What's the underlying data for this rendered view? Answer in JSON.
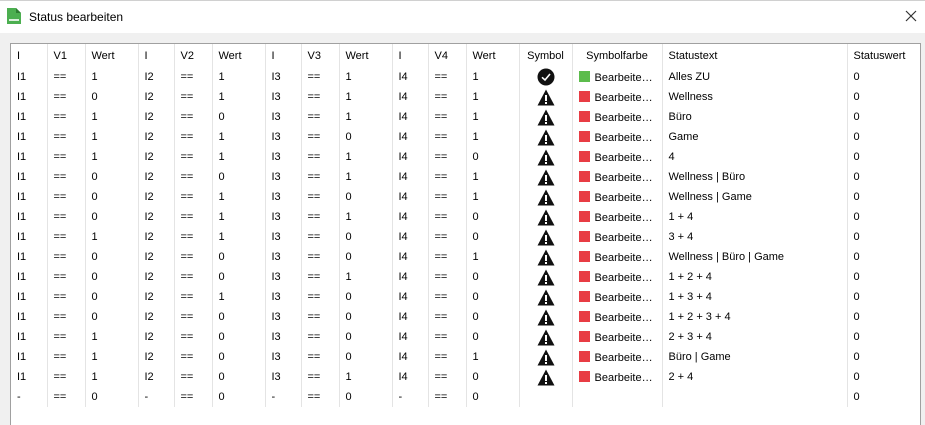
{
  "window": {
    "title": "Status bearbeiten"
  },
  "colors": {
    "green": "#5cbc4c",
    "red": "#e83c44"
  },
  "columns": [
    "I",
    "V1",
    "Wert",
    "I",
    "V2",
    "Wert",
    "I",
    "V3",
    "Wert",
    "I",
    "V4",
    "Wert",
    "Symbol",
    "Symbolfarbe",
    "Statustext",
    "Statuswert"
  ],
  "rows": [
    {
      "i1": "I1",
      "v1": "==",
      "w1": "1",
      "i2": "I2",
      "v2": "==",
      "w2": "1",
      "i3": "I3",
      "v3": "==",
      "w3": "1",
      "i4": "I4",
      "v4": "==",
      "w4": "1",
      "symbol": "check-icon",
      "color": "green",
      "color_label": "Bearbeiten...",
      "text": "Alles ZU",
      "value": "0"
    },
    {
      "i1": "I1",
      "v1": "==",
      "w1": "0",
      "i2": "I2",
      "v2": "==",
      "w2": "1",
      "i3": "I3",
      "v3": "==",
      "w3": "1",
      "i4": "I4",
      "v4": "==",
      "w4": "1",
      "symbol": "warning-icon",
      "color": "red",
      "color_label": "Bearbeiten...",
      "text": "Wellness",
      "value": "0"
    },
    {
      "i1": "I1",
      "v1": "==",
      "w1": "1",
      "i2": "I2",
      "v2": "==",
      "w2": "0",
      "i3": "I3",
      "v3": "==",
      "w3": "1",
      "i4": "I4",
      "v4": "==",
      "w4": "1",
      "symbol": "warning-icon",
      "color": "red",
      "color_label": "Bearbeiten...",
      "text": "Büro",
      "value": "0"
    },
    {
      "i1": "I1",
      "v1": "==",
      "w1": "1",
      "i2": "I2",
      "v2": "==",
      "w2": "1",
      "i3": "I3",
      "v3": "==",
      "w3": "0",
      "i4": "I4",
      "v4": "==",
      "w4": "1",
      "symbol": "warning-icon",
      "color": "red",
      "color_label": "Bearbeiten...",
      "text": "Game",
      "value": "0"
    },
    {
      "i1": "I1",
      "v1": "==",
      "w1": "1",
      "i2": "I2",
      "v2": "==",
      "w2": "1",
      "i3": "I3",
      "v3": "==",
      "w3": "1",
      "i4": "I4",
      "v4": "==",
      "w4": "0",
      "symbol": "warning-icon",
      "color": "red",
      "color_label": "Bearbeiten...",
      "text": "4",
      "value": "0"
    },
    {
      "i1": "I1",
      "v1": "==",
      "w1": "0",
      "i2": "I2",
      "v2": "==",
      "w2": "0",
      "i3": "I3",
      "v3": "==",
      "w3": "1",
      "i4": "I4",
      "v4": "==",
      "w4": "1",
      "symbol": "warning-icon",
      "color": "red",
      "color_label": "Bearbeiten...",
      "text": "Wellness | Büro",
      "value": "0"
    },
    {
      "i1": "I1",
      "v1": "==",
      "w1": "0",
      "i2": "I2",
      "v2": "==",
      "w2": "1",
      "i3": "I3",
      "v3": "==",
      "w3": "0",
      "i4": "I4",
      "v4": "==",
      "w4": "1",
      "symbol": "warning-icon",
      "color": "red",
      "color_label": "Bearbeiten...",
      "text": "Wellness | Game",
      "value": "0"
    },
    {
      "i1": "I1",
      "v1": "==",
      "w1": "0",
      "i2": "I2",
      "v2": "==",
      "w2": "1",
      "i3": "I3",
      "v3": "==",
      "w3": "1",
      "i4": "I4",
      "v4": "==",
      "w4": "0",
      "symbol": "warning-icon",
      "color": "red",
      "color_label": "Bearbeiten...",
      "text": "1 + 4",
      "value": "0"
    },
    {
      "i1": "I1",
      "v1": "==",
      "w1": "1",
      "i2": "I2",
      "v2": "==",
      "w2": "1",
      "i3": "I3",
      "v3": "==",
      "w3": "0",
      "i4": "I4",
      "v4": "==",
      "w4": "0",
      "symbol": "warning-icon",
      "color": "red",
      "color_label": "Bearbeiten...",
      "text": "3 + 4",
      "value": "0"
    },
    {
      "i1": "I1",
      "v1": "==",
      "w1": "0",
      "i2": "I2",
      "v2": "==",
      "w2": "0",
      "i3": "I3",
      "v3": "==",
      "w3": "0",
      "i4": "I4",
      "v4": "==",
      "w4": "1",
      "symbol": "warning-icon",
      "color": "red",
      "color_label": "Bearbeiten...",
      "text": "Wellness | Büro | Game",
      "value": "0"
    },
    {
      "i1": "I1",
      "v1": "==",
      "w1": "0",
      "i2": "I2",
      "v2": "==",
      "w2": "0",
      "i3": "I3",
      "v3": "==",
      "w3": "1",
      "i4": "I4",
      "v4": "==",
      "w4": "0",
      "symbol": "warning-icon",
      "color": "red",
      "color_label": "Bearbeiten...",
      "text": "1 + 2 + 4",
      "value": "0"
    },
    {
      "i1": "I1",
      "v1": "==",
      "w1": "0",
      "i2": "I2",
      "v2": "==",
      "w2": "1",
      "i3": "I3",
      "v3": "==",
      "w3": "0",
      "i4": "I4",
      "v4": "==",
      "w4": "0",
      "symbol": "warning-icon",
      "color": "red",
      "color_label": "Bearbeiten...",
      "text": "1 + 3 + 4",
      "value": "0"
    },
    {
      "i1": "I1",
      "v1": "==",
      "w1": "0",
      "i2": "I2",
      "v2": "==",
      "w2": "0",
      "i3": "I3",
      "v3": "==",
      "w3": "0",
      "i4": "I4",
      "v4": "==",
      "w4": "0",
      "symbol": "warning-icon",
      "color": "red",
      "color_label": "Bearbeiten...",
      "text": "1 + 2 + 3 + 4",
      "value": "0"
    },
    {
      "i1": "I1",
      "v1": "==",
      "w1": "1",
      "i2": "I2",
      "v2": "==",
      "w2": "0",
      "i3": "I3",
      "v3": "==",
      "w3": "0",
      "i4": "I4",
      "v4": "==",
      "w4": "0",
      "symbol": "warning-icon",
      "color": "red",
      "color_label": "Bearbeiten...",
      "text": "2 + 3 + 4",
      "value": "0"
    },
    {
      "i1": "I1",
      "v1": "==",
      "w1": "1",
      "i2": "I2",
      "v2": "==",
      "w2": "0",
      "i3": "I3",
      "v3": "==",
      "w3": "0",
      "i4": "I4",
      "v4": "==",
      "w4": "1",
      "symbol": "warning-icon",
      "color": "red",
      "color_label": "Bearbeiten...",
      "text": "Büro | Game",
      "value": "0"
    },
    {
      "i1": "I1",
      "v1": "==",
      "w1": "1",
      "i2": "I2",
      "v2": "==",
      "w2": "0",
      "i3": "I3",
      "v3": "==",
      "w3": "1",
      "i4": "I4",
      "v4": "==",
      "w4": "0",
      "symbol": "warning-icon",
      "color": "red",
      "color_label": "Bearbeiten...",
      "text": "2 + 4",
      "value": "0"
    },
    {
      "i1": "-",
      "v1": "==",
      "w1": "0",
      "i2": "-",
      "v2": "==",
      "w2": "0",
      "i3": "-",
      "v3": "==",
      "w3": "0",
      "i4": "-",
      "v4": "==",
      "w4": "0",
      "symbol": "",
      "color": "",
      "color_label": "",
      "text": "",
      "value": "0"
    }
  ]
}
